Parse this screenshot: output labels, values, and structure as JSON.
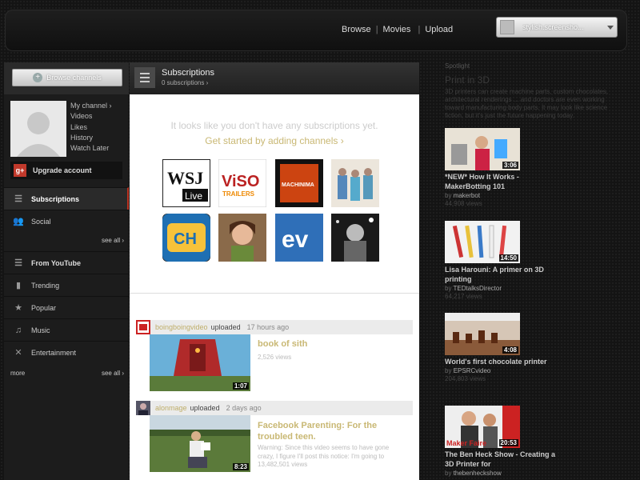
{
  "header": {
    "nav": [
      "Browse",
      "Movies",
      "Upload"
    ],
    "user_name": "stylish.screensho..."
  },
  "sidebar": {
    "browse_channels": "Browse channels",
    "profile_links": [
      "My channel ›",
      "Videos",
      "Likes",
      "History",
      "Watch Later"
    ],
    "upgrade": "Upgrade account",
    "items": [
      {
        "label": "Subscriptions",
        "icon": "list-icon"
      },
      {
        "label": "Social",
        "icon": "people-icon"
      },
      {
        "label": "From YouTube",
        "icon": "list-icon"
      },
      {
        "label": "Trending",
        "icon": "bars-icon"
      },
      {
        "label": "Popular",
        "icon": "star-icon"
      },
      {
        "label": "Music",
        "icon": "headphones-icon"
      },
      {
        "label": "Entertainment",
        "icon": "entertainment-icon"
      }
    ],
    "see_all": "see all ›",
    "more": "more"
  },
  "main": {
    "title": "Subscriptions",
    "count": "0 subscriptions ›",
    "empty_message": "It looks like you don't have any subscriptions yet.",
    "get_started": "Get started by adding channels ›",
    "channels": [
      {
        "text": "WSJ",
        "sub": "Live"
      },
      {
        "text": "ViSO",
        "sub": "TRAILERS"
      },
      {
        "text": "MACHINIMA",
        "sub": ""
      },
      {
        "text": "",
        "sub": ""
      },
      {
        "text": "CH",
        "sub": ""
      },
      {
        "text": "",
        "sub": ""
      },
      {
        "text": "ev",
        "sub": ""
      },
      {
        "text": "",
        "sub": ""
      }
    ],
    "feed": [
      {
        "user": "boingboingvideo",
        "action": "uploaded",
        "when": "17 hours ago",
        "title": "book of sith",
        "description": "",
        "views": "2,526 views",
        "duration": "1:07"
      },
      {
        "user": "alonmage",
        "action": "uploaded",
        "when": "2 days ago",
        "title": "Facebook Parenting: For the troubled teen.",
        "description": "Warning: Since this video seems to have gone crazy, I figure I'll post this notice: I'm going to",
        "views": "13,482,501 views",
        "duration": "8:23"
      }
    ]
  },
  "spotlight": {
    "label": "Spotlight",
    "title": "Print in 3D",
    "description": "3D printers can create machine parts, custom chocolates, architectural renderings ... and doctors are even working toward manufacturing body parts. It may look like science fiction, but it's just the future happening today.",
    "videos": [
      {
        "title": "*NEW* How It Works - MakerBotting 101",
        "by": "by",
        "channel": "makerbot",
        "views": "44,908 views",
        "duration": "3:06"
      },
      {
        "title": "Lisa Harouni: A primer on 3D printing",
        "by": "by",
        "channel": "TEDtalksDirector",
        "views": "64,217 views",
        "duration": "14:50"
      },
      {
        "title": "World's first chocolate printer",
        "by": "by",
        "channel": "EPSRCvideo",
        "views": "204,803 views",
        "duration": "4:08"
      },
      {
        "title": "The Ben Heck Show - Creating a 3D Printer for",
        "by": "by",
        "channel": "thebenheckshow",
        "views": "",
        "duration": "20:53"
      }
    ]
  }
}
